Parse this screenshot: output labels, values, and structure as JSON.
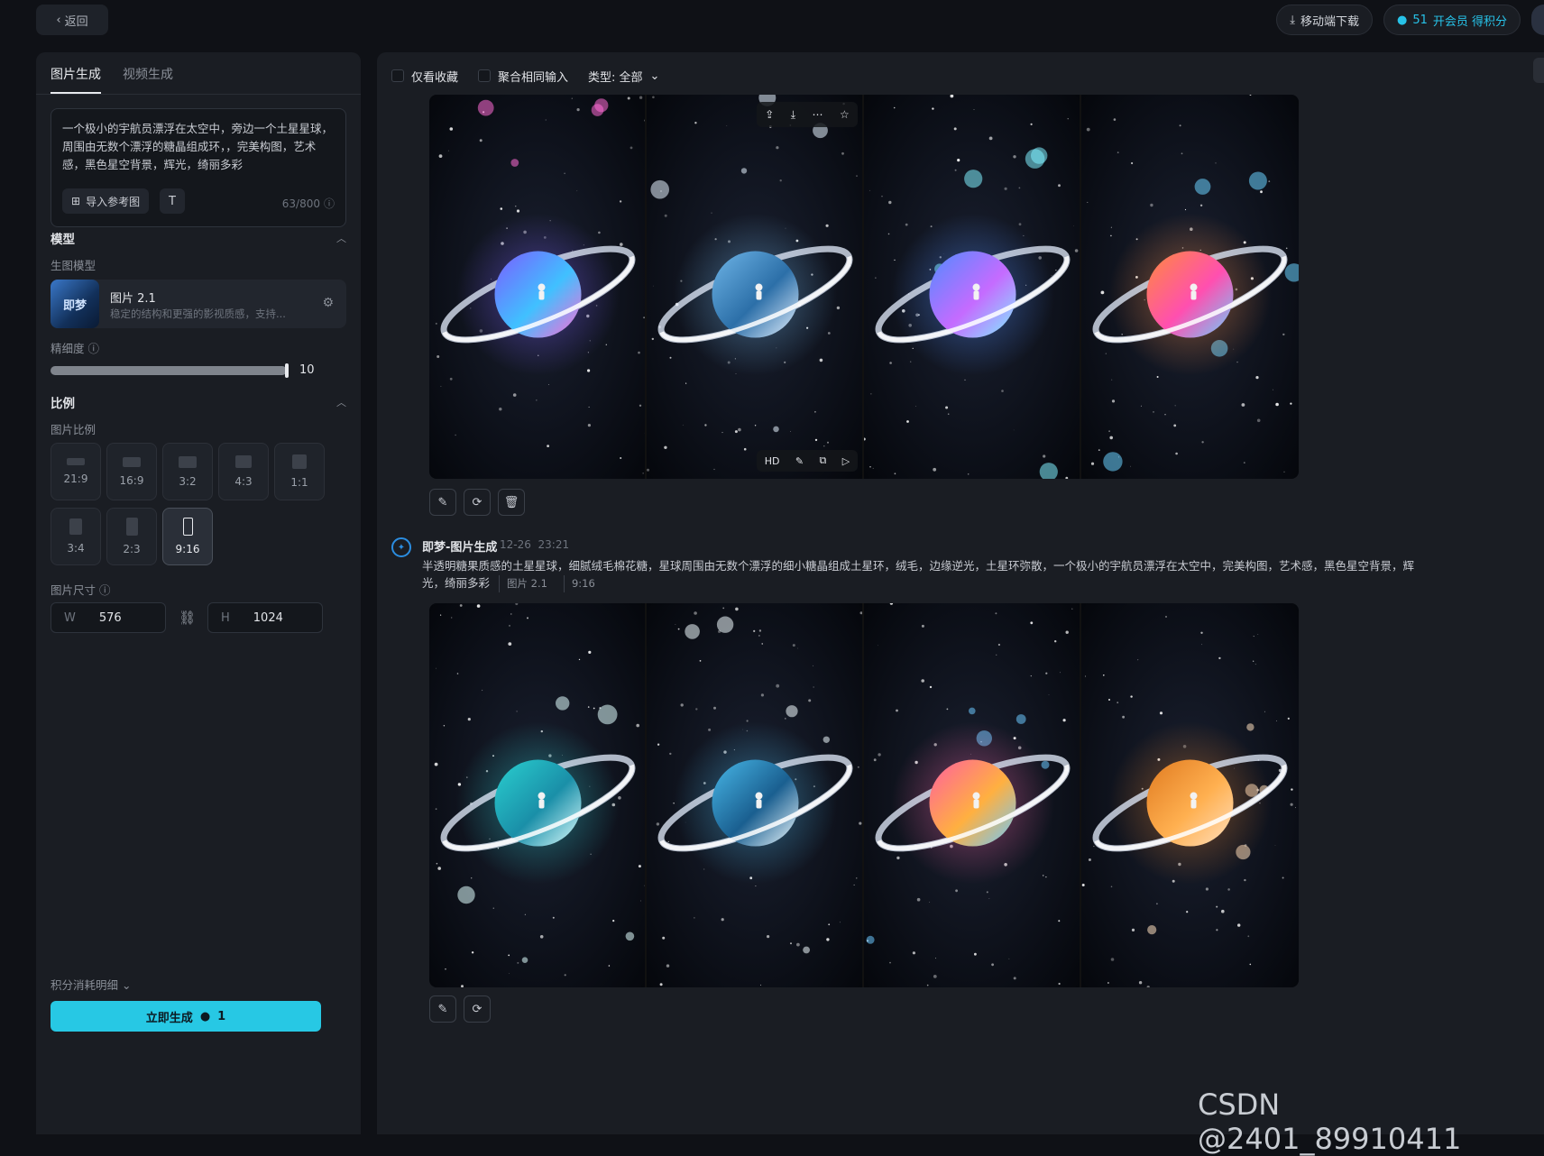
{
  "topbar": {
    "back_label": "返回",
    "mobile_download": "移动端下载",
    "credits": "51",
    "vip_label": "开会员 得积分"
  },
  "sidebar": {
    "tabs": [
      "图片生成",
      "视频生成"
    ],
    "prompt": "一个极小的宇航员漂浮在太空中，旁边一个土星星球，周围由无数个漂浮的糖晶组成环，，完美构图，艺术感，黑色星空背景，辉光，绮丽多彩",
    "import_label": "导入参考图",
    "text_btn": "T",
    "char_count": "63/800",
    "model_section": "模型",
    "model_sub": "生图模型",
    "model_name": "图片 2.1",
    "model_desc": "稳定的结构和更强的影视质感，支持...",
    "model_thumb_text": "即梦",
    "detail_label": "精细度",
    "detail_value": "10",
    "detail_fraction": 1.0,
    "ratio_section": "比例",
    "ratio_sub": "图片比例",
    "ratios": [
      "21:9",
      "16:9",
      "3:2",
      "4:3",
      "1:1",
      "3:4",
      "2:3",
      "9:16"
    ],
    "active_ratio": "9:16",
    "size_label": "图片尺寸",
    "width_label": "W",
    "width_value": "576",
    "height_label": "H",
    "height_value": "1024",
    "cost_label": "积分消耗明细",
    "generate_label": "立即生成",
    "generate_cost": "1"
  },
  "main": {
    "filter_favorites": "仅看收藏",
    "filter_merge": "聚合相同输入",
    "filter_type": "类型: 全部",
    "hover_bottom": [
      "HD"
    ],
    "generation": {
      "title": "即梦-图片生成",
      "date": "12-26",
      "time": "23:21",
      "prompt": "半透明糖果质感的土星星球，细腻绒毛棉花糖，星球周围由无数个漂浮的细小糖晶组成土星环，绒毛，边缘逆光，土星环弥散，一个极小的宇航员漂浮在太空中，完美构图，艺术感，黑色星空背景，辉光，绮丽多彩",
      "tag_model": "图片 2.1",
      "tag_ratio": "9:16"
    }
  },
  "watermark": "CSDN @2401_89910411",
  "colors": {
    "accent": "#27c8e4",
    "panel": "#1a1d23",
    "background": "#0f1116"
  }
}
